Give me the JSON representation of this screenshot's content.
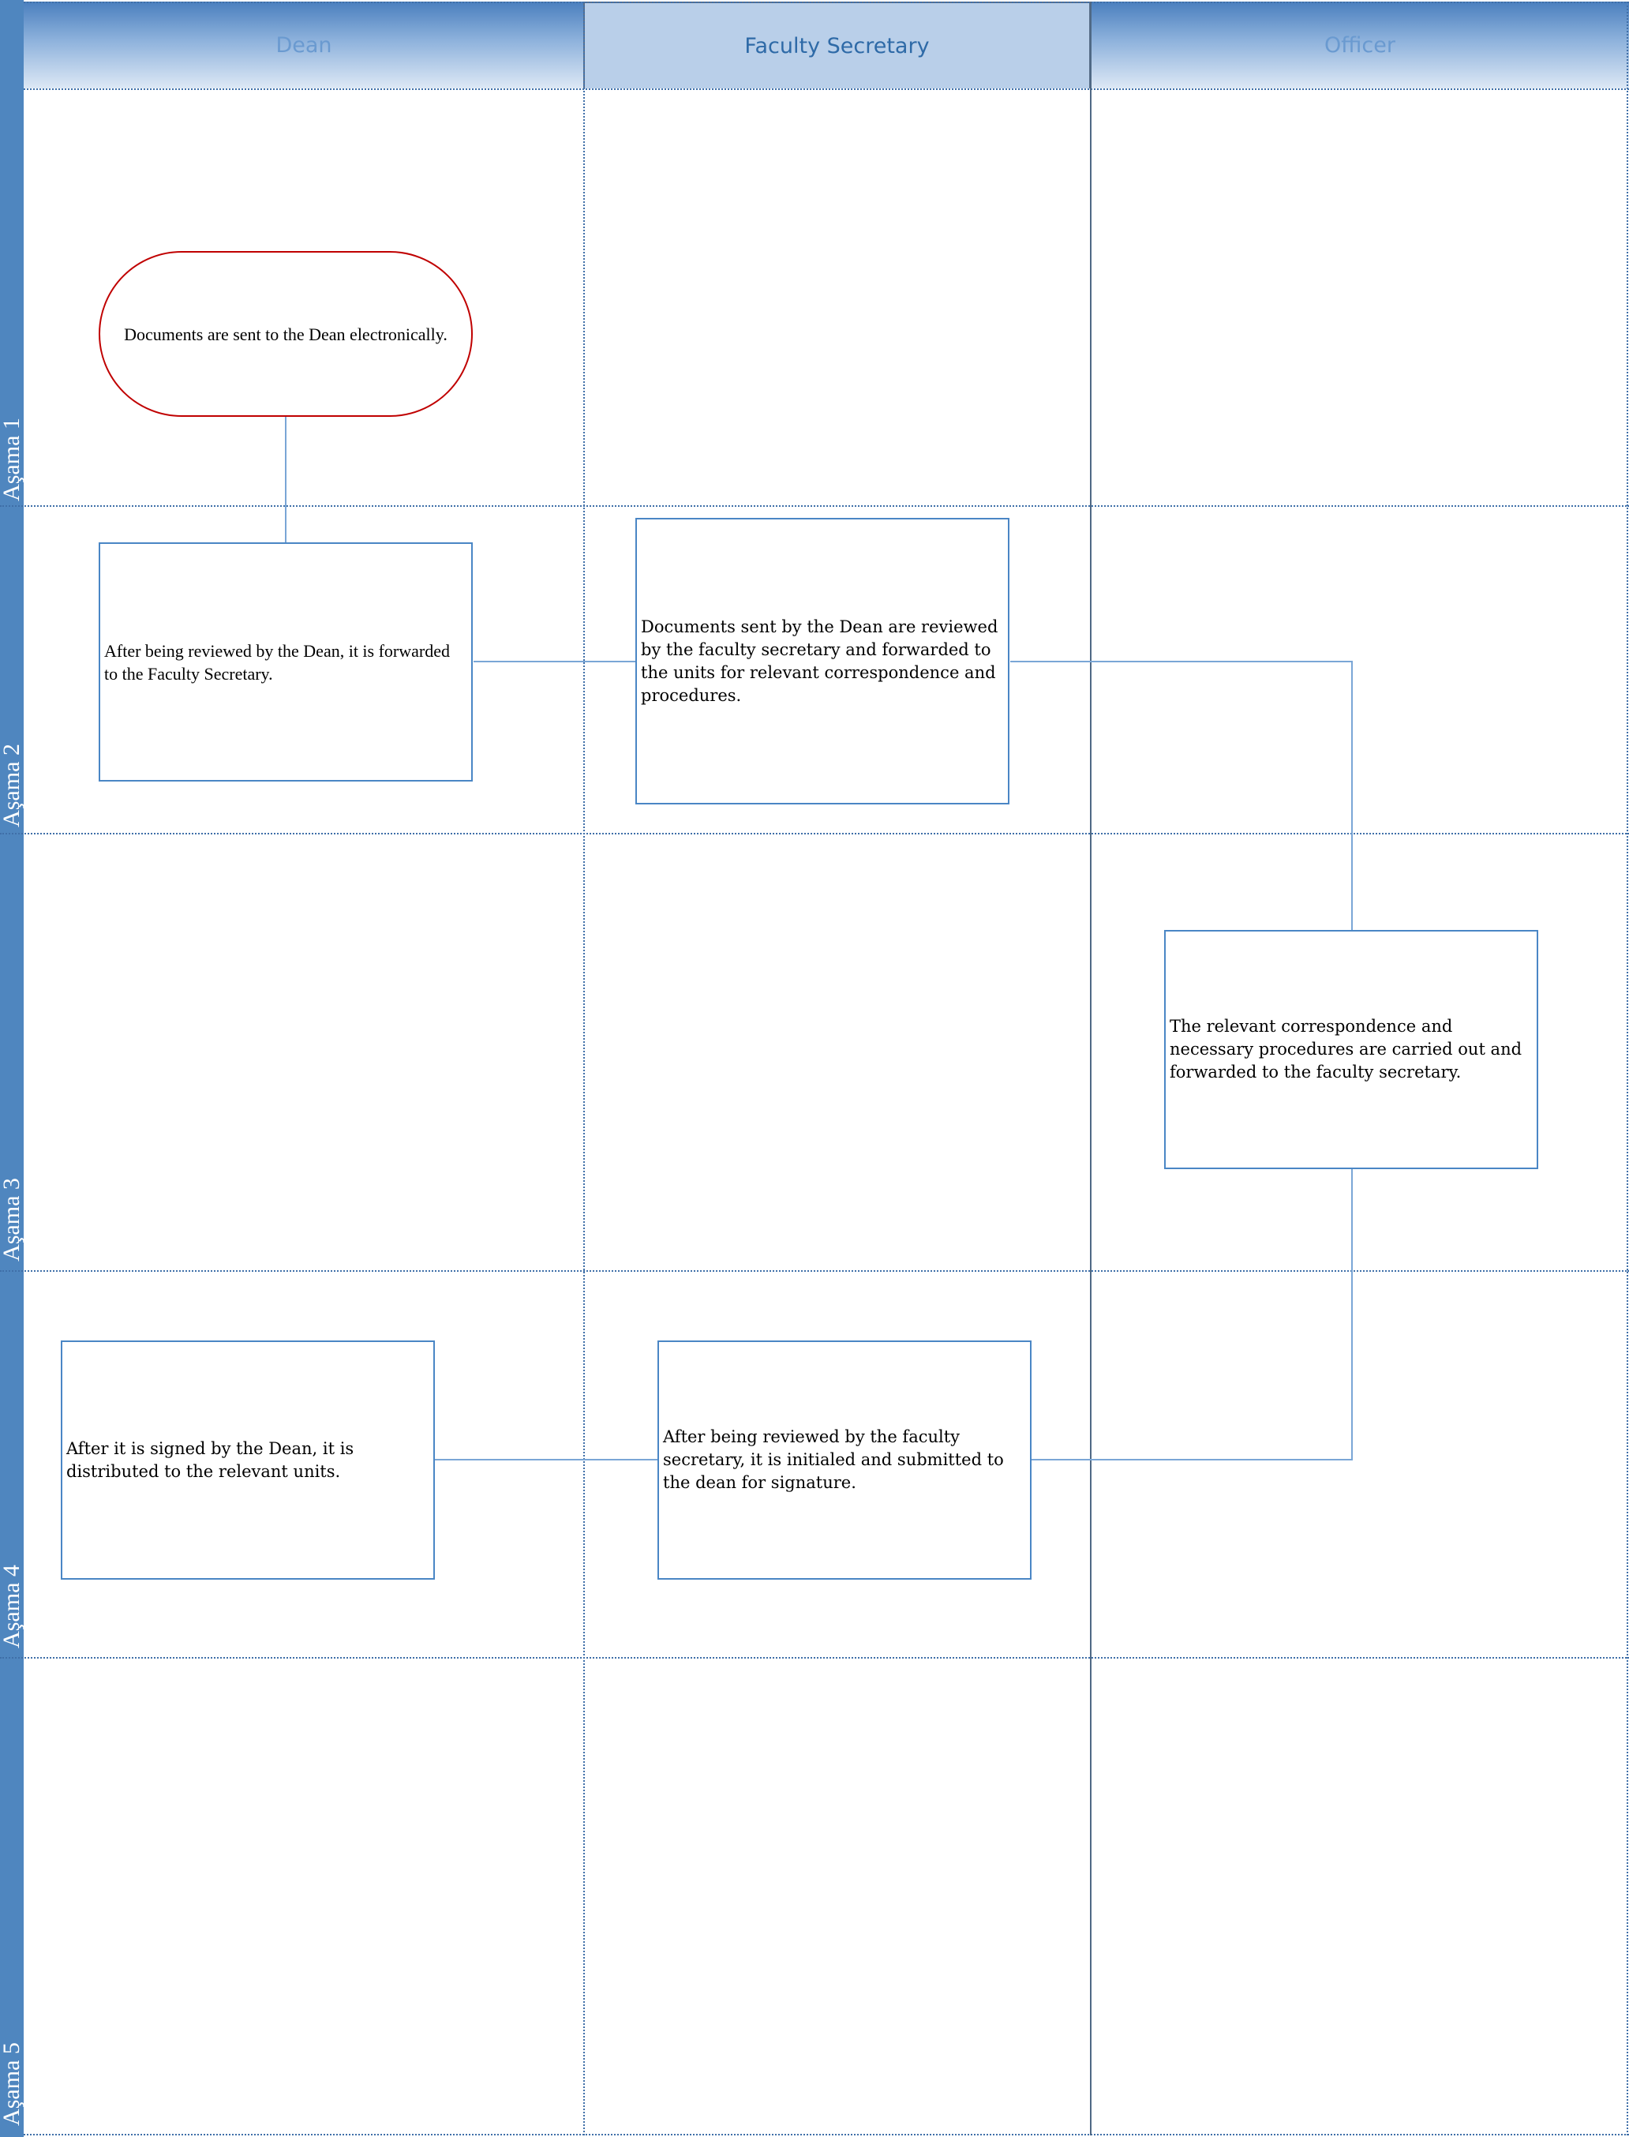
{
  "lanes": {
    "dean": "Dean",
    "faculty_secretary": "Faculty Secretary",
    "officer": "Officer"
  },
  "phases": [
    "Aşama 1",
    "Aşama 2",
    "Aşama 3",
    "Aşama 4",
    "Aşama 5"
  ],
  "steps": {
    "start": "Documents are sent to the Dean electronically.",
    "dean_review": "After being reviewed by the Dean, it is forwarded to the Faculty Secretary.",
    "secretary_forward": "Documents sent by the Dean are reviewed by the faculty secretary and forwarded to the units for relevant correspondence and procedures.",
    "officer_process": "The relevant correspondence and necessary procedures are carried out and forwarded to the faculty secretary.",
    "secretary_initial": "After being reviewed by the faculty secretary, it is initialed and submitted to the dean for signature.",
    "dean_distribute": "After it is signed by the Dean, it is distributed to the relevant units."
  },
  "colors": {
    "phase_band": "#4f86bf",
    "lane_header_gradient_top": "#4a7fbe",
    "lane_header_active": "#b9cfe9",
    "shape_border": "#4a86c5",
    "terminator_border": "#c00000",
    "connector": "#7aa6d6",
    "grid_line": "#3f6fa8"
  }
}
